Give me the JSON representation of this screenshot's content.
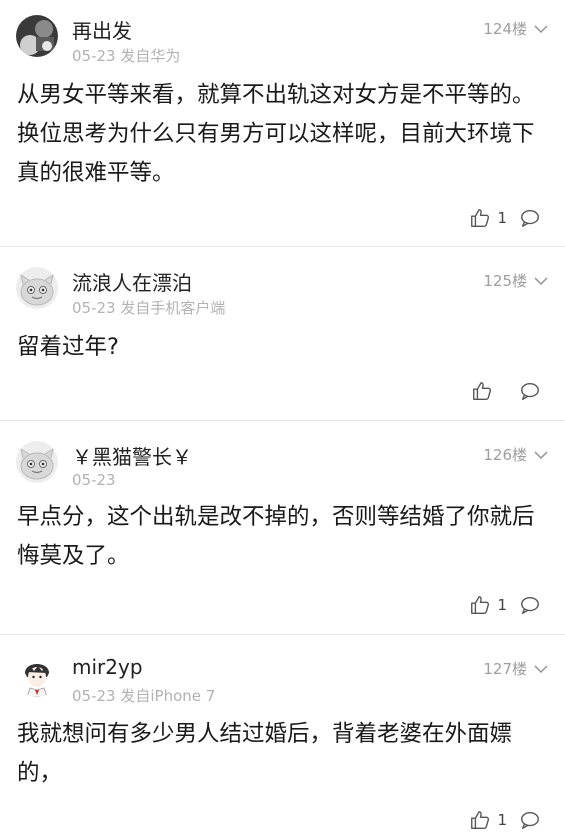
{
  "posts": [
    {
      "username": "再出发",
      "meta": "05-23 发自华为",
      "floor": "124楼",
      "content": "从男女平等来看，就算不出轨这对女方是不平等的。换位思考为什么只有男方可以这样呢，目前大环境下真的很难平等。",
      "likes": "1",
      "avatar_icon": "photo-avatar-icon"
    },
    {
      "username": "流浪人在漂泊",
      "meta": "05-23 发自手机客户端",
      "floor": "125楼",
      "content": "留着过年?",
      "likes": "",
      "avatar_icon": "default-face-avatar-icon"
    },
    {
      "username": "￥黑猫警长￥",
      "meta": "05-23",
      "floor": "126楼",
      "content": "早点分，这个出轨是改不掉的，否则等结婚了你就后悔莫及了。",
      "likes": "1",
      "avatar_icon": "default-face-avatar-icon"
    },
    {
      "username": "mir2yp",
      "meta": "05-23 发自iPhone 7",
      "floor": "127楼",
      "content": "我就想问有多少男人结过婚后，背着老婆在外面嫖的，",
      "likes": "1",
      "avatar_icon": "anime-boy-avatar-icon"
    }
  ],
  "icons": {
    "floor_menu": "chevron-down-icon",
    "like": "thumbs-up-icon",
    "comment": "comment-bubble-icon"
  }
}
